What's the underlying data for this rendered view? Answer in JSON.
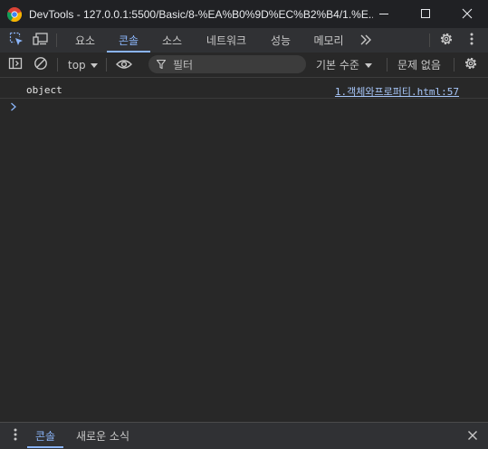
{
  "window": {
    "title": "DevTools - 127.0.0.1:5500/Basic/8-%EA%B0%9D%EC%B2%B4/1.%E...",
    "minimize_icon": "minimize-icon",
    "maximize_icon": "maximize-icon",
    "close_icon": "close-icon"
  },
  "tabs": {
    "items": [
      "요소",
      "콘솔",
      "소스",
      "네트워크",
      "성능",
      "메모리"
    ],
    "active": "콘솔",
    "more_icon": "chevron-double-right-icon"
  },
  "console_toolbar": {
    "context": "top",
    "filter_placeholder": "필터",
    "log_level": "기본 수준",
    "issues": "문제 없음"
  },
  "console": {
    "messages": [
      {
        "text": "object",
        "source": "1.객체와프로퍼티.html:57"
      }
    ],
    "prompt_icon": "chevron-right-icon"
  },
  "drawer": {
    "tabs": [
      "콘솔",
      "새로운 소식"
    ],
    "active": "콘솔"
  },
  "colors": {
    "accent": "#8ab4f8",
    "link": "#a8c7fa",
    "background": "#282828",
    "titlebar": "#202124"
  }
}
